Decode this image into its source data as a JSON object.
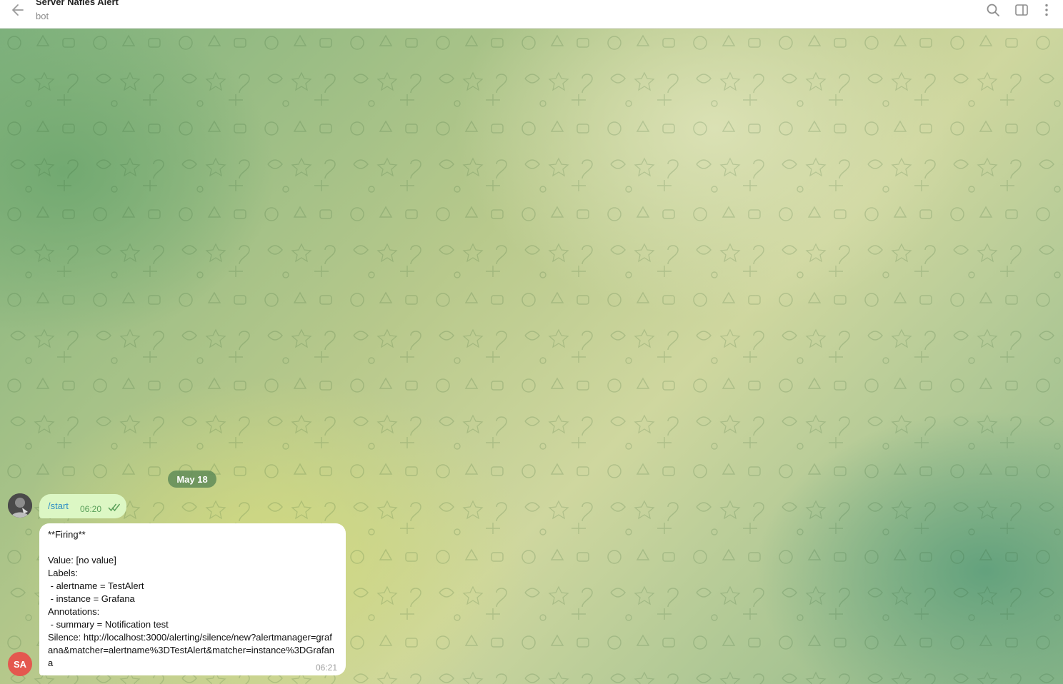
{
  "header": {
    "title": "Server Nafies Alert",
    "subtitle": "bot",
    "icons": [
      "back-arrow-icon",
      "search-icon",
      "sidebar-toggle-icon",
      "more-vertical-icon"
    ]
  },
  "chat": {
    "date_separator": "May 18",
    "messages": [
      {
        "direction": "outgoing",
        "text": "/start",
        "time": "06:20",
        "status": "read"
      },
      {
        "direction": "incoming",
        "sender_initials": "SA",
        "text": "**Firing**\n\nValue: [no value]\nLabels:\n - alertname = TestAlert\n - instance = Grafana\nAnnotations:\n - summary = Notification test\nSilence: http://localhost:3000/alerting/silence/new?alertmanager=grafana&matcher=alertname%3DTestAlert&matcher=instance%3DGrafana",
        "time": "06:21"
      }
    ]
  },
  "colors": {
    "outgoing_bubble": "#dcf7c4",
    "incoming_bubble": "#ffffff",
    "link": "#2f8fc4",
    "bot_avatar": "#e4584f"
  }
}
